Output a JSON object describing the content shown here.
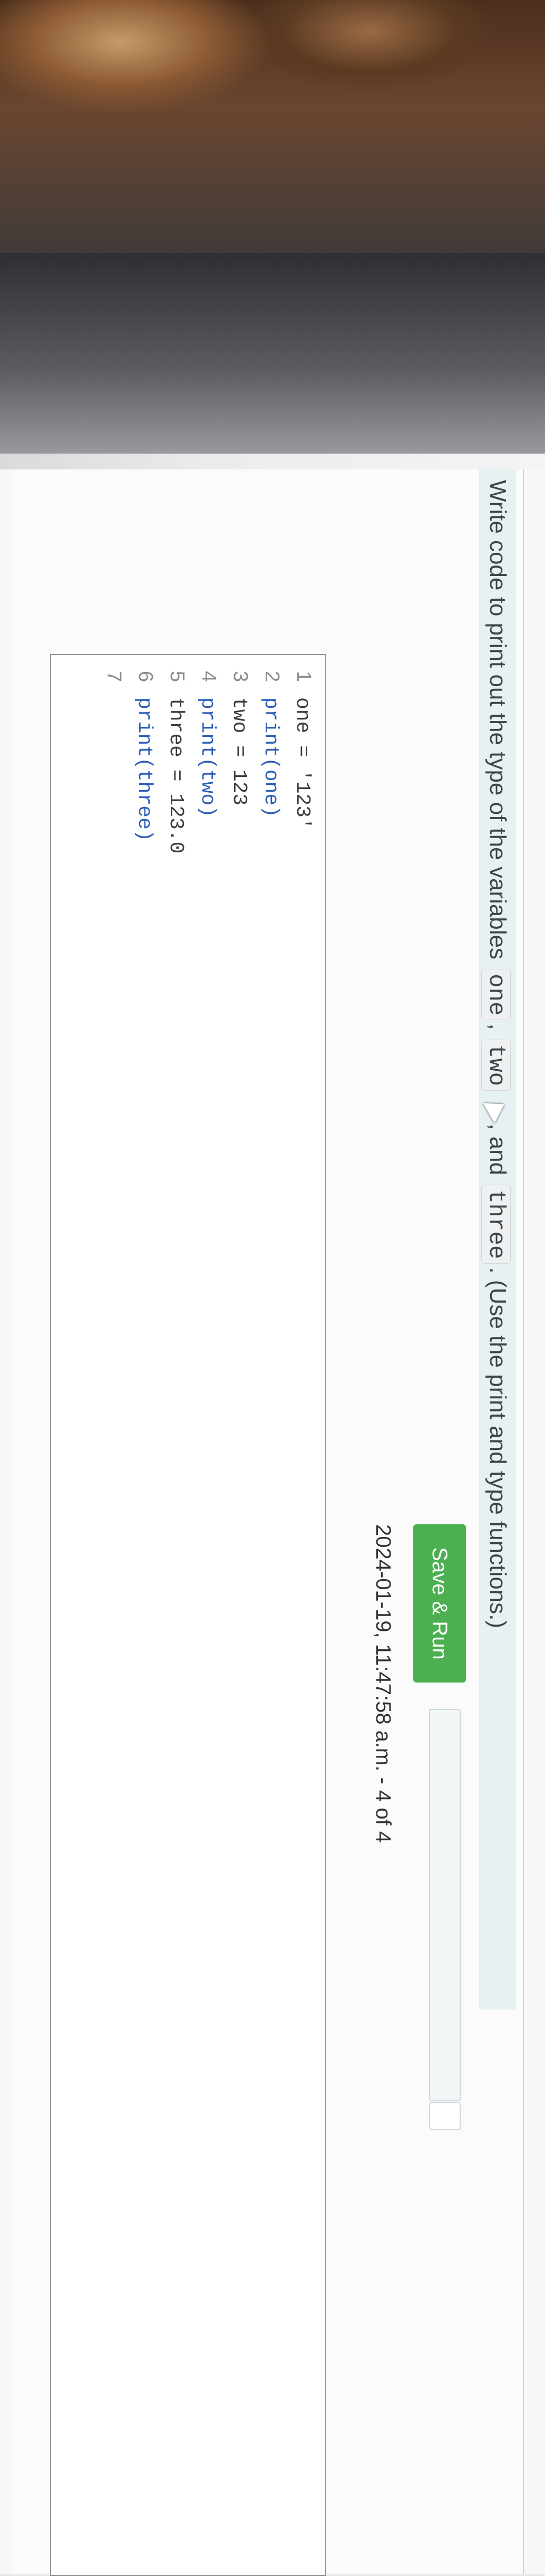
{
  "prompt": {
    "before": "Write code to print out the type of the variables",
    "var1": "one",
    "comma1": ",",
    "var2": "two",
    "comma2": ", and",
    "var3": "three",
    "after": ". (Use the print and type functions.)"
  },
  "actions": {
    "save_run_label": "Save & Run",
    "progress_fraction": 0.0,
    "timestamp": "2024-01-19, 11:47:58 a.m. - 4 of 4"
  },
  "editor": {
    "lines": [
      {
        "n": "1",
        "code": "one = '123'"
      },
      {
        "n": "2",
        "code": "print(one)"
      },
      {
        "n": "3",
        "code": "two = 123"
      },
      {
        "n": "4",
        "code": "print(two)"
      },
      {
        "n": "5",
        "code": "three = 123.0"
      },
      {
        "n": "6",
        "code": "print(three)"
      },
      {
        "n": "7",
        "code": ""
      }
    ]
  },
  "colors": {
    "save_button": "#4caf50",
    "prompt_bg": "#e7f1f4"
  }
}
